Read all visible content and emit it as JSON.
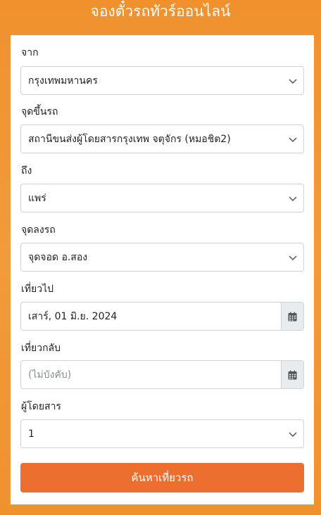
{
  "header": {
    "title": "จองตั๋วรถทัวร์ออนไลน์"
  },
  "form": {
    "from": {
      "label": "จาก",
      "value": "กรุงเทพมหานคร"
    },
    "pickup": {
      "label": "จุดขึ้นรถ",
      "value": "สถานีขนส่งผู้โดยสารกรุงเทพ จตุจักร (หมอชิต2)"
    },
    "to": {
      "label": "ถึง",
      "value": "แพร่"
    },
    "dropoff": {
      "label": "จุดลงรถ",
      "value": "จุดจอด อ.สอง"
    },
    "depart": {
      "label": "เที่ยวไป",
      "value": "เสาร์, 01 มิ.ย. 2024"
    },
    "return": {
      "label": "เที่ยวกลับ",
      "placeholder": "(ไม่บังคับ)"
    },
    "passengers": {
      "label": "ผู้โดยสาร",
      "value": "1"
    },
    "search_button": "ค้นหาเที่ยวรถ"
  },
  "icons": {
    "dropdown": "chevron-down-icon",
    "date": "calendar-icon"
  },
  "colors": {
    "brand": "#f0912e",
    "button": "#ec6f2f"
  }
}
